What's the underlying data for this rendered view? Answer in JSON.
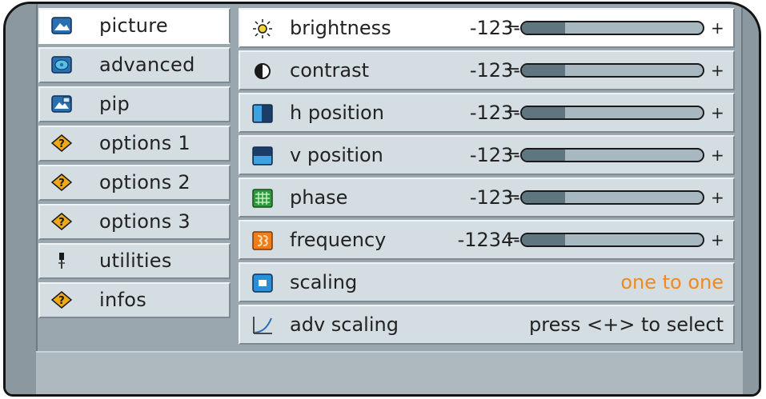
{
  "menu": {
    "items": [
      {
        "label": "picture",
        "icon": "picture-icon"
      },
      {
        "label": "advanced",
        "icon": "advanced-icon"
      },
      {
        "label": "pip",
        "icon": "pip-icon"
      },
      {
        "label": "options 1",
        "icon": "options-icon"
      },
      {
        "label": "options 2",
        "icon": "options-icon"
      },
      {
        "label": "options 3",
        "icon": "options-icon"
      },
      {
        "label": "utilities",
        "icon": "utilities-icon"
      },
      {
        "label": "infos",
        "icon": "infos-icon"
      }
    ]
  },
  "settings": {
    "rows": [
      {
        "label": "brightness",
        "value": "-123-",
        "minus": "−",
        "plus": "+",
        "level": 0.24
      },
      {
        "label": "contrast",
        "value": "-123-",
        "minus": "−",
        "plus": "+",
        "level": 0.24
      },
      {
        "label": "h position",
        "value": "-123-",
        "minus": "−",
        "plus": "+",
        "level": 0.24
      },
      {
        "label": "v position",
        "value": "-123-",
        "minus": "−",
        "plus": "+",
        "level": 0.24
      },
      {
        "label": "phase",
        "value": "-123-",
        "minus": "−",
        "plus": "+",
        "level": 0.24
      },
      {
        "label": "frequency",
        "value": "-1234-",
        "minus": "−",
        "plus": "+",
        "level": 0.24
      }
    ],
    "scaling": {
      "label": "scaling",
      "value": "one to one"
    },
    "adv_scaling": {
      "label": "adv scaling",
      "value": "press <+> to select"
    }
  },
  "colors": {
    "accent_orange": "#f08a1e",
    "text": "#222222"
  }
}
